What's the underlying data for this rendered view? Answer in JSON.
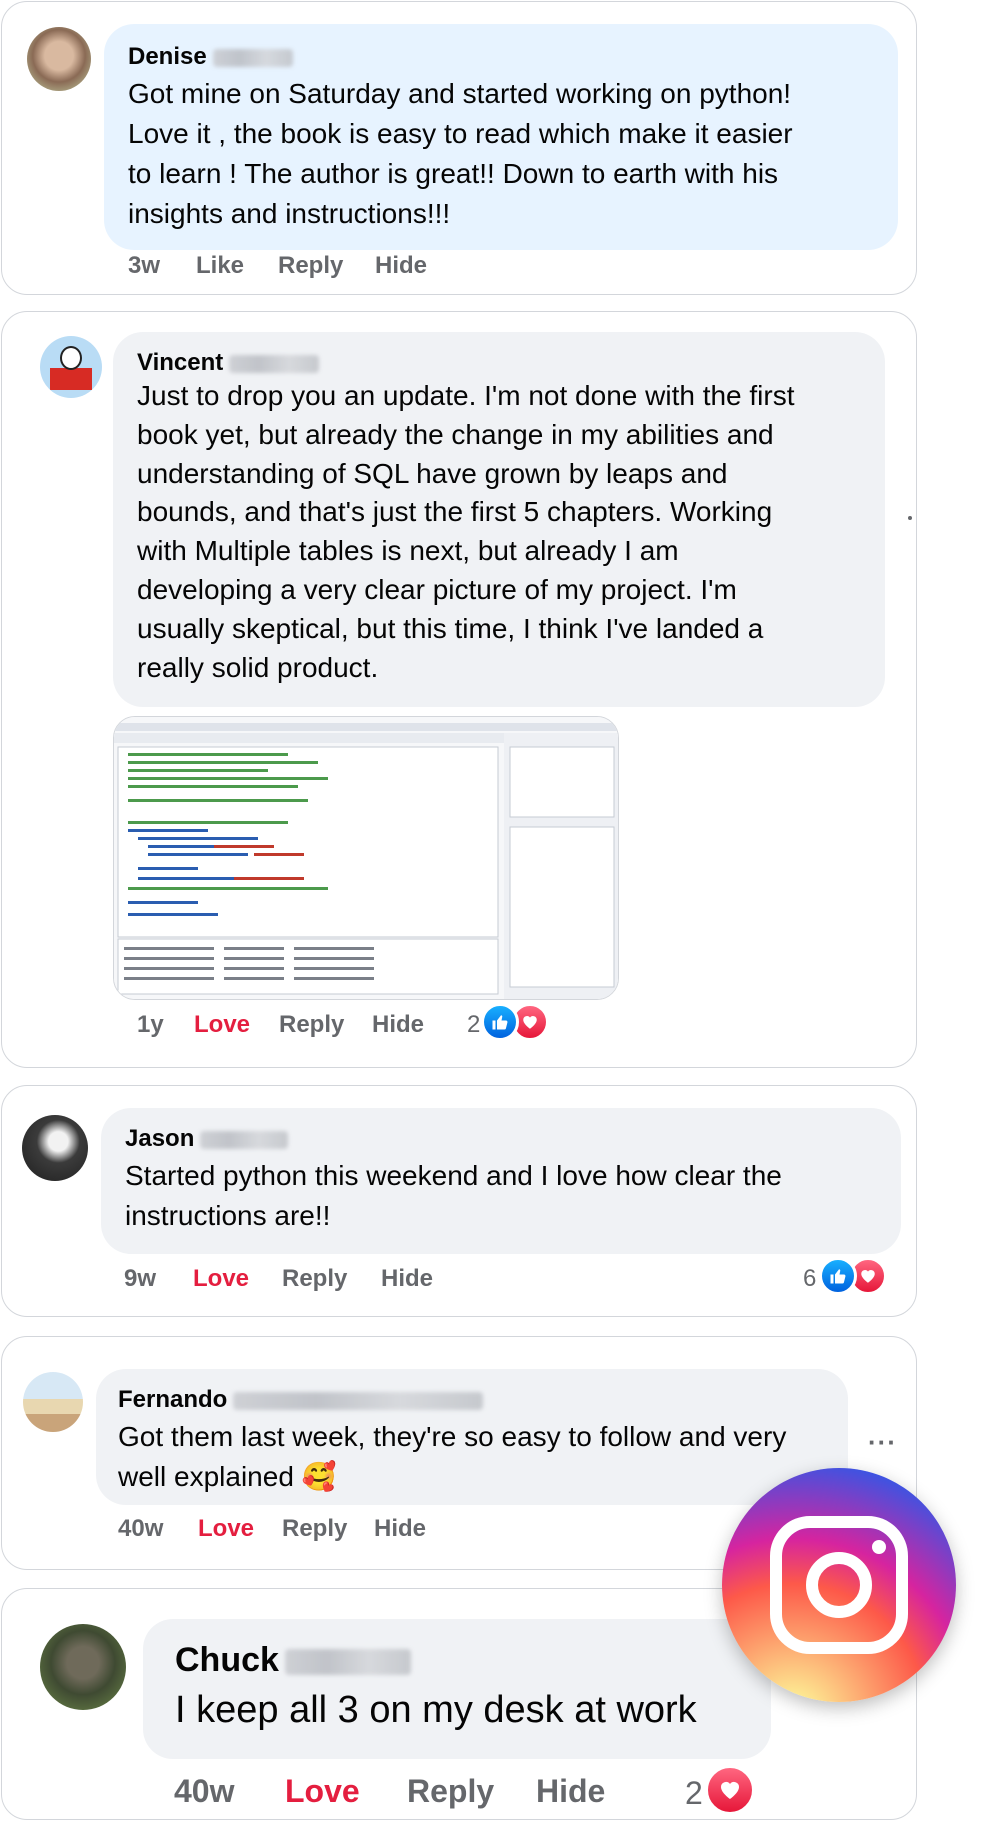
{
  "comments": [
    {
      "name": "Denise",
      "bubble_color": "#e7f3ff",
      "text": "Got mine on Saturday and started working on python!\nLove it , the book is easy to read which make it easier\nto learn ! The author is great!! Down to earth with his\ninsights and instructions!!!",
      "time": "3w",
      "reaction_label": "Like",
      "reply_label": "Reply",
      "hide_label": "Hide"
    },
    {
      "name": "Vincent",
      "bubble_color": "#f0f2f5",
      "text": "Just to drop you an update. I'm not done with the first\nbook yet, but already the change in my abilities and\nunderstanding of SQL have grown by leaps and\nbounds, and that's just the first 5 chapters. Working\nwith Multiple tables is next, but already I am\ndeveloping a very clear picture of my project. I'm\nusually skeptical, but this time, I think I've landed a\nreally solid product.",
      "time": "1y",
      "reaction_label": "Love",
      "reply_label": "Reply",
      "hide_label": "Hide",
      "reaction_count": "2"
    },
    {
      "name": "Jason",
      "bubble_color": "#f0f2f5",
      "text": "Started python this weekend and I love how clear the\ninstructions are!!",
      "time": "9w",
      "reaction_label": "Love",
      "reply_label": "Reply",
      "hide_label": "Hide",
      "reaction_count": "6"
    },
    {
      "name": "Fernando",
      "bubble_color": "#f0f2f5",
      "text": "Got them last week, they're so easy to follow and very\nwell explained 🥰",
      "time": "40w",
      "reaction_label": "Love",
      "reply_label": "Reply",
      "hide_label": "Hide",
      "more_label": "···"
    },
    {
      "name": "Chuck",
      "bubble_color": "#f0f2f5",
      "text": "I keep all 3 on my desk at work",
      "time": "40w",
      "reaction_label": "Love",
      "reply_label": "Reply",
      "hide_label": "Hide",
      "reaction_count": "2"
    }
  ],
  "colors": {
    "love": "#e41e3f",
    "meta_text": "#65676b",
    "like_icon": "#0866ff",
    "border": "#d3d6db"
  },
  "icons": [
    "like-icon",
    "love-icon",
    "instagram-logo",
    "more-options-icon"
  ]
}
